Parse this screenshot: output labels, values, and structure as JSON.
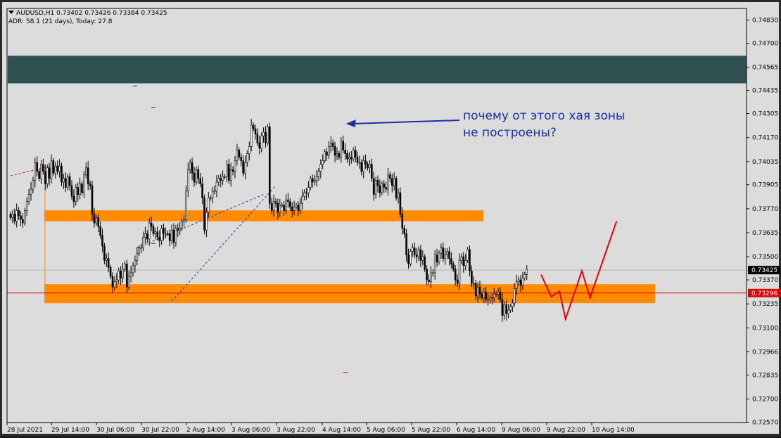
{
  "header": {
    "symbol_line": "AUDUSD,H1  0.73402 0.73426 0.73384 0.73425",
    "adr_line": "ADR: 58.1 (21 days), Today: 27.8"
  },
  "annotation": {
    "line1": "почему от этого хая зоны",
    "line2": "не построены?"
  },
  "colors": {
    "background": "#dcdcdc",
    "zone_dark": "#2e5050",
    "zone_orange": "#ff8c00",
    "price_line": "#b0b0b0",
    "alert_line": "#e00000",
    "arrow": "#1b2ea3",
    "pattern_line": "#e00000"
  },
  "chart_data": {
    "type": "candlestick",
    "symbol": "AUDUSD",
    "timeframe": "H1",
    "ylim": [
      0.72568,
      0.74896
    ],
    "y_ticks": [
      "0.74830",
      "0.74700",
      "0.74565",
      "0.74435",
      "0.74305",
      "0.74170",
      "0.74035",
      "0.73905",
      "0.73770",
      "0.73635",
      "0.73500",
      "0.73370",
      "0.73235",
      "0.73100",
      "0.72966",
      "0.72835",
      "0.72700",
      "0.72570"
    ],
    "x_ticks": [
      "28 Jul 2021",
      "29 Jul 14:00",
      "30 Jul 06:00",
      "30 Jul 22:00",
      "2 Aug 14:00",
      "3 Aug 06:00",
      "3 Aug 22:00",
      "4 Aug 14:00",
      "5 Aug 06:00",
      "5 Aug 22:00",
      "6 Aug 14:00",
      "9 Aug 06:00",
      "9 Aug 22:00",
      "10 Aug 14:00"
    ],
    "current_price": "0.73425",
    "current_price_value": 0.73425,
    "alert_price": "0.73296",
    "alert_price_value": 0.73296,
    "zones": [
      {
        "name": "dark-zone",
        "from": 0.74475,
        "to": 0.7463,
        "color": "#2e5050"
      },
      {
        "name": "orange-zone-upper",
        "from": 0.73715,
        "to": 0.73745,
        "color": "#ff8c00"
      },
      {
        "name": "orange-zone-lower",
        "from": 0.73255,
        "to": 0.7333,
        "color": "#ff8c00"
      }
    ],
    "closes": [
      0.7372,
      0.7374,
      0.737,
      0.7376,
      0.7373,
      0.7371,
      0.7369,
      0.7376,
      0.7381,
      0.7385,
      0.7388,
      0.7393,
      0.7403,
      0.7398,
      0.7394,
      0.7402,
      0.7398,
      0.7391,
      0.74,
      0.7394,
      0.7404,
      0.7397,
      0.7401,
      0.7398,
      0.7401,
      0.7392,
      0.7394,
      0.7389,
      0.7395,
      0.739,
      0.7384,
      0.7381,
      0.7389,
      0.7385,
      0.7391,
      0.7386,
      0.7396,
      0.74,
      0.7391,
      0.739,
      0.7374,
      0.7369,
      0.7372,
      0.7367,
      0.7362,
      0.7356,
      0.7348,
      0.7349,
      0.7344,
      0.7339,
      0.7333,
      0.7336,
      0.7337,
      0.7342,
      0.7338,
      0.7343,
      0.7346,
      0.7333,
      0.7339,
      0.7341,
      0.7345,
      0.7348,
      0.7352,
      0.7355,
      0.7355,
      0.7361,
      0.7363,
      0.736,
      0.7369,
      0.7367,
      0.7363,
      0.7364,
      0.7361,
      0.7359,
      0.7366,
      0.7363,
      0.7363,
      0.7363,
      0.7359,
      0.7365,
      0.7358,
      0.7366,
      0.7365,
      0.7366,
      0.737,
      0.7371,
      0.7387,
      0.7399,
      0.7403,
      0.7397,
      0.7392,
      0.7399,
      0.7394,
      0.7391,
      0.7383,
      0.7365,
      0.7375,
      0.7383,
      0.7383,
      0.7387,
      0.7387,
      0.7392,
      0.7394,
      0.7393,
      0.7395,
      0.7395,
      0.7402,
      0.7393,
      0.7399,
      0.7398,
      0.7404,
      0.741,
      0.7406,
      0.7404,
      0.7397,
      0.7403,
      0.7408,
      0.7412,
      0.7424,
      0.7422,
      0.7419,
      0.7414,
      0.7411,
      0.7418,
      0.742,
      0.7414,
      0.7423,
      0.738,
      0.7376,
      0.7381,
      0.738,
      0.7375,
      0.7379,
      0.7379,
      0.7376,
      0.7382,
      0.7381,
      0.7378,
      0.7376,
      0.7378,
      0.7379,
      0.7376,
      0.738,
      0.7384,
      0.7386,
      0.7386,
      0.7389,
      0.7394,
      0.7392,
      0.7393,
      0.7395,
      0.7398,
      0.7402,
      0.7404,
      0.7409,
      0.7407,
      0.7412,
      0.7414,
      0.7412,
      0.7407,
      0.7408,
      0.7406,
      0.7415,
      0.741,
      0.7408,
      0.7405,
      0.7406,
      0.7405,
      0.741,
      0.7406,
      0.7403,
      0.7403,
      0.7398,
      0.7404,
      0.7402,
      0.74,
      0.7402,
      0.7394,
      0.7385,
      0.7393,
      0.739,
      0.7386,
      0.7391,
      0.7389,
      0.7388,
      0.7396,
      0.7394,
      0.739,
      0.7394,
      0.7383,
      0.7386,
      0.7374,
      0.7366,
      0.7363,
      0.7351,
      0.7346,
      0.7353,
      0.7355,
      0.7351,
      0.735,
      0.7354,
      0.7348,
      0.735,
      0.7343,
      0.7337,
      0.7336,
      0.7341,
      0.7341,
      0.7351,
      0.7347,
      0.7352,
      0.7355,
      0.7349,
      0.7351,
      0.7353,
      0.7349,
      0.7346,
      0.7343,
      0.7337,
      0.7335,
      0.7348,
      0.735,
      0.7345,
      0.7348,
      0.7354,
      0.7342,
      0.7335,
      0.7335,
      0.7328,
      0.7333,
      0.7329,
      0.7327,
      0.733,
      0.7326,
      0.7326,
      0.7327,
      0.7327,
      0.7329,
      0.7329,
      0.733,
      0.7326,
      0.7317,
      0.7323,
      0.7318,
      0.732,
      0.7322,
      0.7324,
      0.7332,
      0.7336,
      0.7337,
      0.7334,
      0.7338,
      0.734,
      0.7343
    ],
    "pattern_path": [
      [
        260,
        0.734
      ],
      [
        265,
        0.73275
      ],
      [
        269,
        0.73305
      ],
      [
        272,
        0.7315
      ],
      [
        280,
        0.7342
      ],
      [
        284,
        0.7327
      ],
      [
        297,
        0.737
      ]
    ],
    "dashed_lines": [
      {
        "from": [
          62,
          0.7355
        ],
        "to": [
          124,
          0.7385
        ],
        "color": "#1b2ea3"
      },
      {
        "from": [
          79,
          0.7325
        ],
        "to": [
          130,
          0.739
        ],
        "color": "#1b2ea3"
      },
      {
        "from": [
          0,
          0.73955
        ],
        "to": [
          20,
          0.7401
        ],
        "color": "#e00000"
      }
    ],
    "small_marks": [
      {
        "x": 61,
        "y": 0.7446,
        "color": "#1b2ea3"
      },
      {
        "x": 70,
        "y": 0.7434,
        "color": "#1b2ea3"
      },
      {
        "x": 70,
        "y": 0.73575,
        "color": "#e00000"
      },
      {
        "x": 164,
        "y": 0.7285,
        "color": "#e00000"
      }
    ],
    "arrow_target_index": 163
  }
}
